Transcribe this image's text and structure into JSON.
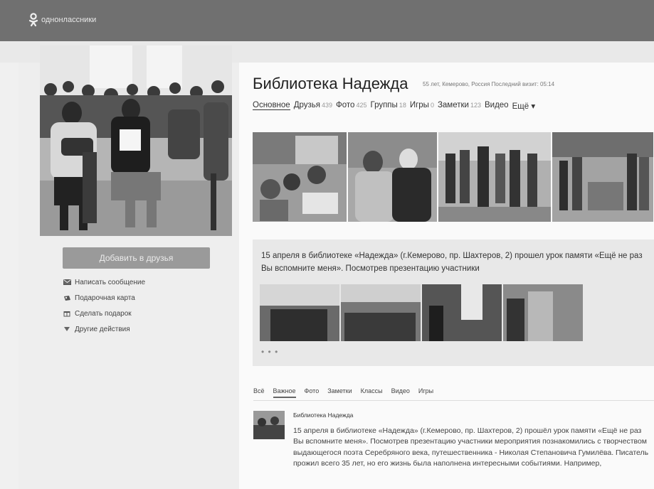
{
  "brand": {
    "name": "однонлассники",
    "icon": "ok-logo-icon"
  },
  "profile": {
    "name": "Библиотека Надежда",
    "meta": "55 лет, Кемерово, Россия Последний визит: 05:14",
    "add_friend_label": "Добавить в друзья",
    "actions": [
      {
        "icon": "envelope-icon",
        "label": "Написать сообщение"
      },
      {
        "icon": "gift-card-icon",
        "label": "Подарочная карта"
      },
      {
        "icon": "gift-icon",
        "label": "Сделать подарок"
      },
      {
        "icon": "chevron-down-icon",
        "label": "Другие действия"
      }
    ]
  },
  "nav": [
    {
      "label": "Основное",
      "count": ""
    },
    {
      "label": "Друзья",
      "count": "439"
    },
    {
      "label": "Фото",
      "count": "425"
    },
    {
      "label": "Группы",
      "count": "18"
    },
    {
      "label": "Игры",
      "count": "0"
    },
    {
      "label": "Заметки",
      "count": "123"
    },
    {
      "label": "Видео",
      "count": ""
    },
    {
      "label": "Ещё ▾",
      "count": ""
    }
  ],
  "post": {
    "text": "15 апреля в библиотеке «Надежда» (г.Кемерово, пр. Шахтеров, 2) прошел урок памяти «Ещё не раз Вы вспомните меня». Посмотрев презентацию участники",
    "more": "• • •"
  },
  "feed_tabs": [
    "Всё",
    "Важное",
    "Фото",
    "Заметки",
    "Классы",
    "Видео",
    "Игры"
  ],
  "feed_item": {
    "author": "Библиотека Надежда",
    "text": "15 апреля в библиотеке «Надежда» (г.Кемерово, пр. Шахтеров, 2) прошёл урок памяти «Ещё не раз Вы вспомните меня». Посмотрев презентацию участники мероприятия познакомились с творчеством выдающегося поэта Серебряного века, путешественника - Николая Степановича Гумилёва. Писатель прожил всего 35 лет, но его жизнь была наполнена интересными событиями. Например,"
  }
}
